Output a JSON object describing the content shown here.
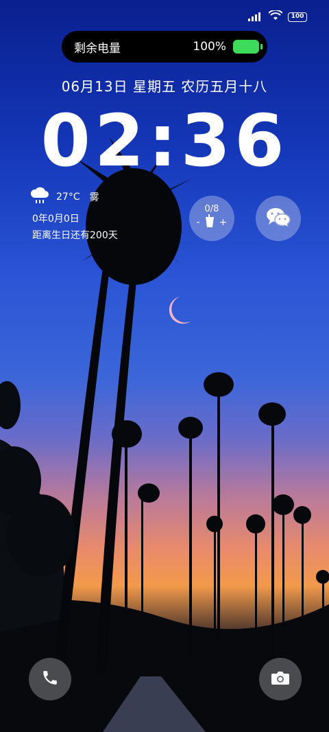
{
  "status_bar": {
    "battery_level": "100",
    "icons": [
      "signal-icon",
      "wifi-icon",
      "battery-icon"
    ]
  },
  "battery_pill": {
    "label": "剩余电量",
    "percent": "100%",
    "level": 1.0,
    "color": "#3ddb5a"
  },
  "date_line": "06月13日 星期五 农历五月十八",
  "clock": "02:36",
  "weather": {
    "icon": "rain-cloud-icon",
    "temperature": "27°C",
    "condition": "雾"
  },
  "info": {
    "line1": "0年0月0日",
    "line2": "距离生日还有200天"
  },
  "water_widget": {
    "count": "0/8",
    "minus": "-",
    "plus": "+",
    "icon": "cup-icon"
  },
  "wechat_widget": {
    "icon": "wechat-icon"
  },
  "shortcuts": {
    "left": "phone-icon",
    "right": "camera-icon"
  }
}
